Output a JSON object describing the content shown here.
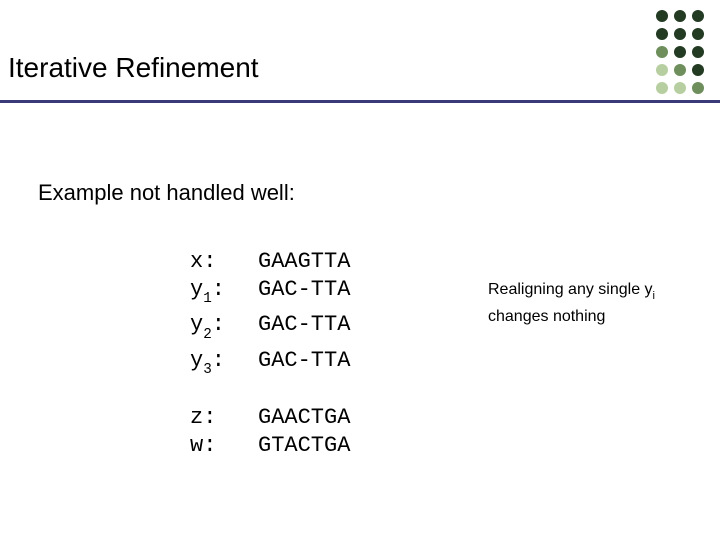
{
  "title": "Iterative Refinement",
  "subheading": "Example not handled well:",
  "alignment": {
    "group1": [
      {
        "label": "x:",
        "seq": "GAAGTTA"
      },
      {
        "label": "y1:",
        "sub": "1",
        "base": "y",
        "seq": "GAC-TTA"
      },
      {
        "label": "y2:",
        "sub": "2",
        "base": "y",
        "seq": "GAC-TTA"
      },
      {
        "label": "y3:",
        "sub": "3",
        "base": "y",
        "seq": "GAC-TTA"
      }
    ],
    "group2": [
      {
        "label": "z:",
        "seq": "GAACTGA"
      },
      {
        "label": "w:",
        "seq": "GTACTGA"
      }
    ]
  },
  "note": {
    "line1_pre": "Realigning any single y",
    "line1_sub": "i",
    "line2": "changes nothing"
  },
  "decor": {
    "dot_rows": [
      [
        "dark",
        "dark",
        "dark"
      ],
      [
        "dark",
        "dark",
        "dark"
      ],
      [
        "mid",
        "dark",
        "dark"
      ],
      [
        "lite",
        "mid",
        "dark"
      ],
      [
        "lite",
        "lite",
        "mid"
      ]
    ]
  }
}
